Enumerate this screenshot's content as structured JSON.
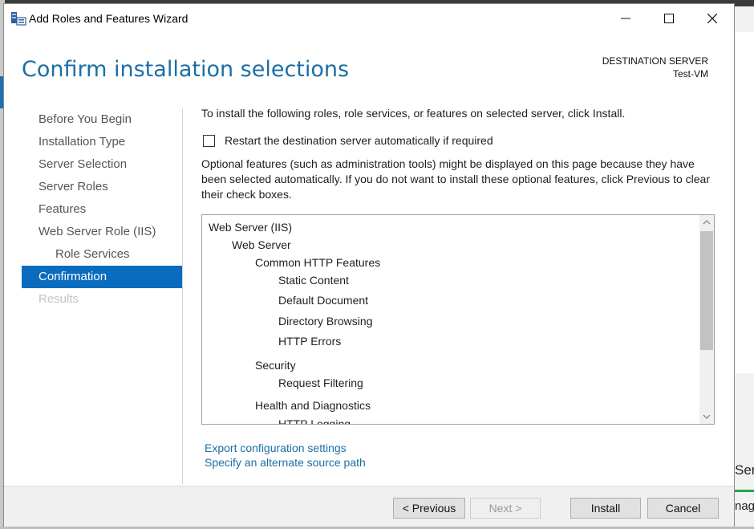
{
  "window": {
    "title": "Add Roles and Features Wizard",
    "minimize": "—",
    "maximize": "☐",
    "close": "✕"
  },
  "header": {
    "page_title": "Confirm installation selections",
    "destination_label": "DESTINATION SERVER",
    "destination_server": "Test-VM"
  },
  "nav": {
    "items": [
      {
        "label": "Before You Begin",
        "state": "normal"
      },
      {
        "label": "Installation Type",
        "state": "normal"
      },
      {
        "label": "Server Selection",
        "state": "normal"
      },
      {
        "label": "Server Roles",
        "state": "normal"
      },
      {
        "label": "Features",
        "state": "normal"
      },
      {
        "label": "Web Server Role (IIS)",
        "state": "normal"
      },
      {
        "label": "Role Services",
        "state": "sub"
      },
      {
        "label": "Confirmation",
        "state": "active"
      },
      {
        "label": "Results",
        "state": "disabled"
      }
    ]
  },
  "content": {
    "intro": "To install the following roles, role services, or features on selected server, click Install.",
    "restart_checkbox_label": "Restart the destination server automatically if required",
    "restart_checked": false,
    "optional_text": "Optional features (such as administration tools) might be displayed on this page because they have been selected automatically. If you do not want to install these optional features, click Previous to clear their check boxes.",
    "selections": [
      "Web Server (IIS)",
      "Web Server",
      "Common HTTP Features",
      "Static Content",
      "Default Document",
      "Directory Browsing",
      "HTTP Errors",
      "Security",
      "Request Filtering",
      "Health and Diagnostics",
      "HTTP Logging"
    ],
    "export_link": "Export configuration settings",
    "alternate_source_link": "Specify an alternate source path"
  },
  "footer": {
    "previous": "< Previous",
    "next": "Next >",
    "install": "Install",
    "cancel": "Cancel"
  },
  "background": {
    "right_text_1": "Ser",
    "right_text_2": "nag"
  },
  "colors": {
    "accent": "#0a6cbe",
    "title_blue": "#1b6fa6",
    "link_blue": "#1b6fa6"
  }
}
